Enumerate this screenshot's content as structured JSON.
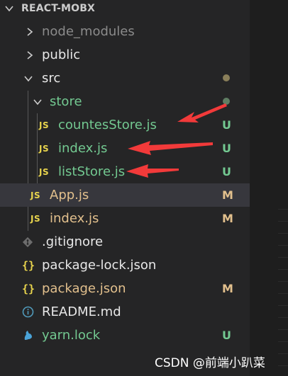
{
  "explorer": {
    "title": "REACT-MOBX",
    "items": [
      {
        "name": "node_modules",
        "status": "",
        "kind": "folder"
      },
      {
        "name": "public",
        "status": "",
        "kind": "folder"
      },
      {
        "name": "src",
        "status": "",
        "kind": "folder"
      },
      {
        "name": "store",
        "status": "",
        "kind": "folder"
      },
      {
        "name": "countesStore.js",
        "status": "U",
        "icon": "JS"
      },
      {
        "name": "index.js",
        "status": "U",
        "icon": "JS"
      },
      {
        "name": "listStore.js",
        "status": "U",
        "icon": "JS"
      },
      {
        "name": "App.js",
        "status": "M",
        "icon": "JS"
      },
      {
        "name": "index.js",
        "status": "M",
        "icon": "JS"
      },
      {
        "name": ".gitignore",
        "status": "",
        "icon": "git-icon"
      },
      {
        "name": "package-lock.json",
        "status": "",
        "icon": "{}"
      },
      {
        "name": "package.json",
        "status": "M",
        "icon": "{}"
      },
      {
        "name": "README.md",
        "status": "",
        "icon": "info-icon"
      },
      {
        "name": "yarn.lock",
        "status": "U",
        "icon": "yarn-icon"
      }
    ]
  },
  "colors": {
    "untracked": "#73c991",
    "modified": "#e2c08d",
    "folder_dot": "#8a7f5a",
    "annotation_arrow": "#f23a3a"
  },
  "watermark": "CSDN @前端小趴菜"
}
